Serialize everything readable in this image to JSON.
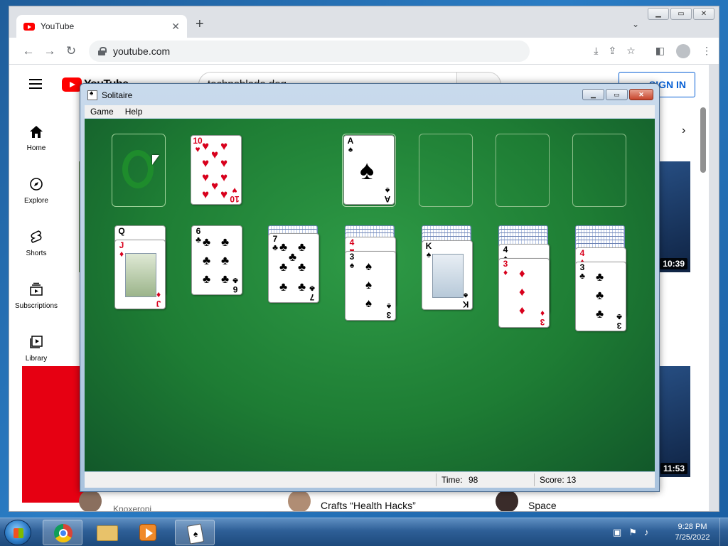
{
  "browser": {
    "tab_title": "YouTube",
    "url": "youtube.com"
  },
  "youtube": {
    "logo_text": "YouTube",
    "search_value": "technoblade dog",
    "sign_in": "SIGN IN",
    "sidebar": [
      {
        "label": "Home",
        "icon": "home-icon"
      },
      {
        "label": "Explore",
        "icon": "compass-icon"
      },
      {
        "label": "Shorts",
        "icon": "shorts-icon"
      },
      {
        "label": "Subscriptions",
        "icon": "subscriptions-icon"
      },
      {
        "label": "Library",
        "icon": "library-icon"
      }
    ],
    "durations": [
      "10:39",
      "11:53"
    ],
    "bottom": {
      "channel": "Knoxeroni",
      "video_title": "Crafts “Health Hacks”",
      "space_title": "Space"
    }
  },
  "solitaire": {
    "title": "Solitaire",
    "menu": [
      "Game",
      "Help"
    ],
    "status": {
      "time_label": "Time:",
      "time_value": "98",
      "score_label": "Score:",
      "score_value": "13"
    },
    "waste": {
      "rank": "10",
      "suit": "♥",
      "color": "red"
    },
    "foundation": {
      "rank": "A",
      "suit": "♠",
      "color": "black"
    },
    "tableau": [
      {
        "hidden": 0,
        "cards": [
          {
            "rank": "Q",
            "suit": "",
            "color": "black"
          },
          {
            "rank": "J",
            "suit": "♦",
            "color": "red"
          }
        ]
      },
      {
        "hidden": 0,
        "cards": [
          {
            "rank": "6",
            "suit": "♣",
            "color": "black"
          }
        ]
      },
      {
        "hidden": 2,
        "cards": [
          {
            "rank": "7",
            "suit": "♣",
            "color": "black"
          }
        ]
      },
      {
        "hidden": 3,
        "cards": [
          {
            "rank": "4",
            "suit": "♥",
            "color": "red"
          },
          {
            "rank": "3",
            "suit": "♠",
            "color": "black"
          }
        ]
      },
      {
        "hidden": 4,
        "cards": [
          {
            "rank": "K",
            "suit": "♠",
            "color": "black"
          }
        ]
      },
      {
        "hidden": 5,
        "cards": [
          {
            "rank": "4",
            "suit": "♠",
            "color": "black"
          },
          {
            "rank": "3",
            "suit": "♦",
            "color": "red"
          }
        ]
      },
      {
        "hidden": 6,
        "cards": [
          {
            "rank": "4",
            "suit": "♦",
            "color": "red"
          },
          {
            "rank": "3",
            "suit": "♣",
            "color": "black"
          }
        ]
      }
    ]
  },
  "taskbar": {
    "time": "9:28 PM",
    "date": "7/25/2022"
  }
}
